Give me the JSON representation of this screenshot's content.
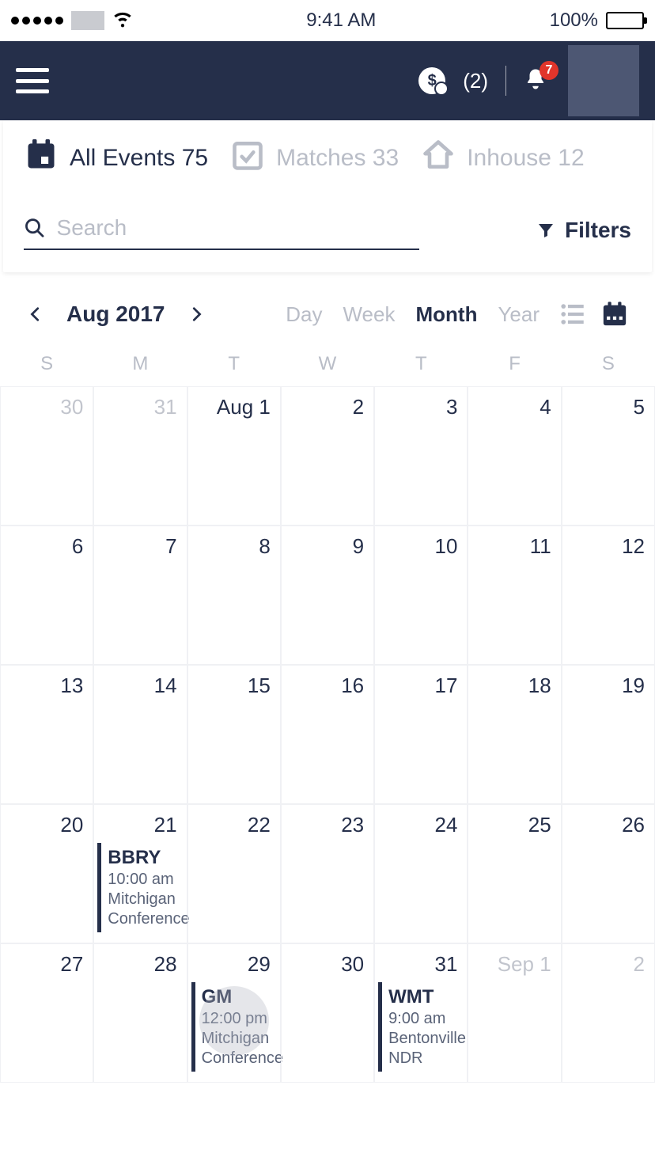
{
  "status_bar": {
    "time": "9:41 AM",
    "battery_label": "100%"
  },
  "header": {
    "money_count": "(2)",
    "notifications_count": "7"
  },
  "tabs": [
    {
      "label": "All Events 75",
      "active": true
    },
    {
      "label": "Matches 33",
      "active": false
    },
    {
      "label": "Inhouse 12",
      "active": false
    }
  ],
  "search": {
    "placeholder": "Search"
  },
  "filters_label": "Filters",
  "calendar": {
    "month_label": "Aug 2017",
    "views": {
      "day": "Day",
      "week": "Week",
      "month": "Month",
      "year": "Year",
      "active": "Month"
    },
    "weekdays": [
      "S",
      "M",
      "T",
      "W",
      "T",
      "F",
      "S"
    ],
    "cells": [
      {
        "label": "30",
        "outside": true
      },
      {
        "label": "31",
        "outside": true
      },
      {
        "label": "Aug 1"
      },
      {
        "label": "2"
      },
      {
        "label": "3"
      },
      {
        "label": "4"
      },
      {
        "label": "5"
      },
      {
        "label": "6"
      },
      {
        "label": "7"
      },
      {
        "label": "8"
      },
      {
        "label": "9"
      },
      {
        "label": "10"
      },
      {
        "label": "11"
      },
      {
        "label": "12"
      },
      {
        "label": "13"
      },
      {
        "label": "14"
      },
      {
        "label": "15"
      },
      {
        "label": "16"
      },
      {
        "label": "17"
      },
      {
        "label": "18"
      },
      {
        "label": "19"
      },
      {
        "label": "20"
      },
      {
        "label": "21",
        "event": {
          "title": "BBRY",
          "time": "10:00 am",
          "line1": "Mitchigan",
          "line2": "Conference"
        }
      },
      {
        "label": "22"
      },
      {
        "label": "23"
      },
      {
        "label": "24"
      },
      {
        "label": "25"
      },
      {
        "label": "26"
      },
      {
        "label": "27"
      },
      {
        "label": "28"
      },
      {
        "label": "29",
        "event": {
          "title": "GM",
          "time": "12:00 pm",
          "line1": "Mitchigan",
          "line2": "Conference"
        },
        "touch": true
      },
      {
        "label": "30"
      },
      {
        "label": "31",
        "event": {
          "title": "WMT",
          "time": "9:00 am",
          "line1": "Bentonville",
          "line2": "NDR"
        }
      },
      {
        "label": "Sep 1",
        "outside": true
      },
      {
        "label": "2",
        "outside": true
      }
    ]
  }
}
